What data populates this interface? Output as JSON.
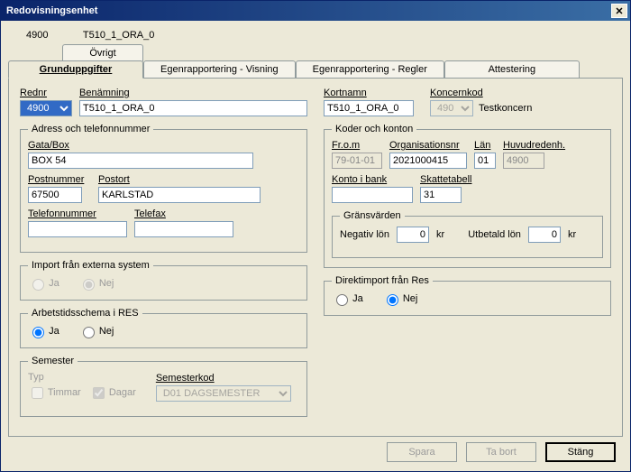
{
  "window": {
    "title": "Redovisningsenhet",
    "close": "✕"
  },
  "meta": {
    "code": "4900",
    "name": "T510_1_ORA_0"
  },
  "tabs": {
    "ovrigt": "Övrigt",
    "grund": "Grunduppgifter",
    "egen_visning": "Egenrapportering - Visning",
    "egen_regler": "Egenrapportering - Regler",
    "attestering": "Attestering"
  },
  "labels": {
    "rednr": "Rednr",
    "benamning": "Benämning",
    "kortnamn": "Kortnamn",
    "koncernkod": "Koncernkod",
    "adress_group": "Adress och telefonnummer",
    "gata": "Gata/Box",
    "postnummer": "Postnummer",
    "postort": "Postort",
    "telefon": "Telefonnummer",
    "telefax": "Telefax",
    "koder_group": "Koder och konton",
    "from": "Fr.o.m",
    "orgnr": "Organisationsnr",
    "lan": "Län",
    "huvudredenh": "Huvudredenh.",
    "konto": "Konto i bank",
    "skatte": "Skattetabell",
    "grans_group": "Gränsvärden",
    "neglon": "Negativ lön",
    "utblon": "Utbetald lön",
    "kr": "kr",
    "import_group": "Import från externa system",
    "arbets_group": "Arbetstidsschema i RES",
    "semester_group": "Semester",
    "typ": "Typ",
    "timmar": "Timmar",
    "dagar": "Dagar",
    "semesterkod": "Semesterkod",
    "direkt_group": "Direktimport från Res",
    "ja": "Ja",
    "nej": "Nej"
  },
  "values": {
    "rednr": "4900",
    "benamning": "T510_1_ORA_0",
    "kortnamn": "T510_1_ORA_0",
    "koncernkod": "490",
    "koncern_text": "Testkoncern",
    "gata": "BOX 54",
    "postnummer": "67500",
    "postort": "KARLSTAD",
    "telefon": "",
    "telefax": "",
    "from": "79-01-01",
    "orgnr": "2021000415",
    "lan": "01",
    "huvudredenh": "4900",
    "konto": "",
    "skatte": "31",
    "neglon": "0",
    "utblon": "0",
    "semesterkod": "D01 DAGSEMESTER"
  },
  "footer": {
    "spara": "Spara",
    "tabort": "Ta bort",
    "stang": "Stäng"
  }
}
